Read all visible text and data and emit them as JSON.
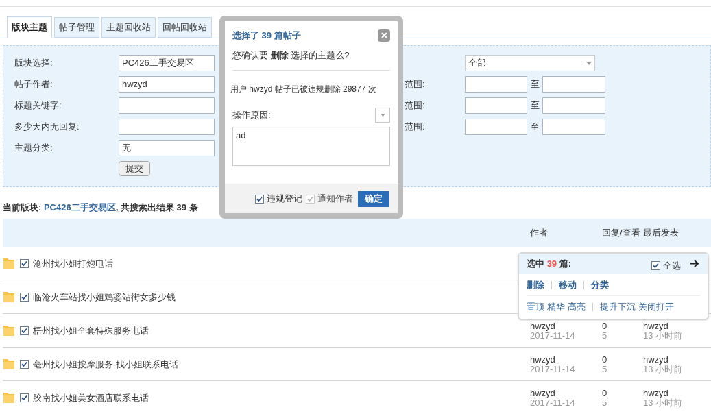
{
  "tabs": [
    {
      "label": "版块主题",
      "selected": true
    },
    {
      "label": "帖子管理",
      "selected": false
    },
    {
      "label": "主题回收站",
      "selected": false
    },
    {
      "label": "回帖回收站",
      "selected": false
    }
  ],
  "filters": {
    "left": [
      {
        "label": "版块选择:",
        "value": "PC426二手交易区"
      },
      {
        "label": "帖子作者:",
        "value": "hwzyd"
      },
      {
        "label": "标题关键字:"
      },
      {
        "label": "多少天内无回复:"
      },
      {
        "label": "主题分类:",
        "value": "无"
      }
    ],
    "submit": "提交",
    "right": [
      {
        "kind": "select",
        "value": "全部"
      },
      {
        "kind": "range",
        "label": "范围:",
        "separator": "至"
      },
      {
        "kind": "range",
        "label": "范围:",
        "separator": "至"
      },
      {
        "kind": "range",
        "label": "范围:",
        "separator": "至"
      }
    ]
  },
  "summary": {
    "prefix": "当前版块:",
    "forum": "PC426二手交易区",
    "suffix": ", 共搜索出结果 39 条"
  },
  "table": {
    "columns": [
      "作者",
      "回复/查看",
      "最后发表"
    ],
    "rows": [
      {
        "title": "沧州找小姐打炮电话",
        "checked": true
      },
      {
        "title": "临沧火车站找小姐鸡婆站街女多少钱",
        "checked": true
      },
      {
        "title": "梧州找小姐全套特殊服务电话",
        "checked": true,
        "author": "hwzyd",
        "date": "2017-11-14",
        "replies": "0",
        "views": "5",
        "last_poster": "hwzyd",
        "last_time": "13 小时前"
      },
      {
        "title": "亳州找小姐按摩服务-找小姐联系电话",
        "checked": true,
        "author": "hwzyd",
        "date": "2017-11-14",
        "replies": "0",
        "views": "5",
        "last_poster": "hwzyd",
        "last_time": "13 小时前"
      },
      {
        "title": "胶南找小姐美女酒店联系电话",
        "checked": true,
        "author": "hwzyd",
        "date": "2017-11-14",
        "replies": "0",
        "views": "5",
        "last_poster": "hwzyd",
        "last_time": "13 小时前"
      }
    ]
  },
  "selection_popup": {
    "prefix": "选中",
    "count": "39",
    "suffix": "篇:",
    "select_all": {
      "label": "全选",
      "checked": true
    },
    "primary_actions": [
      "删除",
      "移动",
      "分类"
    ],
    "secondary_actions": [
      [
        "置顶",
        "精华",
        "高亮"
      ],
      [
        "提升下沉",
        "关闭打开"
      ]
    ]
  },
  "dialog": {
    "title": "选择了 39 篇帖子",
    "question": "您确认要 **删除** 选择的主题么?",
    "info": "用户 hwzyd 帖子已被违规删除 29877 次",
    "reason_label": "操作原因:",
    "reason": "ad",
    "options": [
      {
        "label": "违规登记",
        "checked": true,
        "disabled": false
      },
      {
        "label": "通知作者",
        "checked": true,
        "disabled": true
      }
    ],
    "confirm": "确定"
  }
}
